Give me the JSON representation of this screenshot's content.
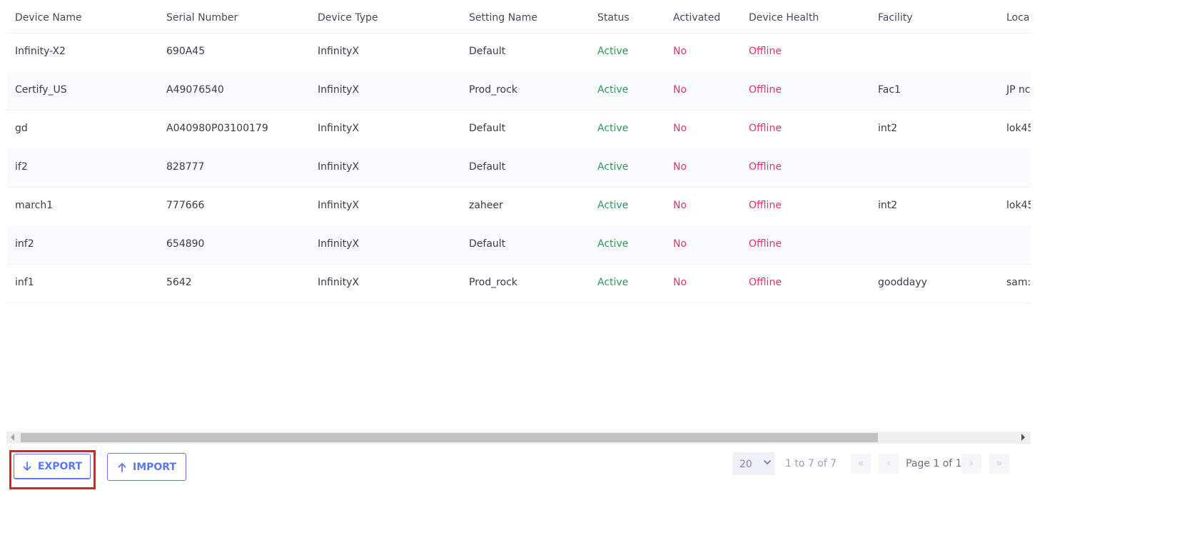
{
  "columns": [
    "Device Name",
    "Serial Number",
    "Device Type",
    "Setting Name",
    "Status",
    "Activated",
    "Device Health",
    "Facility",
    "Loca"
  ],
  "rows": [
    {
      "device_name": "Infinity-X2",
      "serial": "690A45",
      "type": "InfinityX",
      "setting": "Default",
      "status": "Active",
      "activated": "No",
      "health": "Offline",
      "facility": "",
      "location": ""
    },
    {
      "device_name": "Certify_US",
      "serial": "A49076540",
      "type": "InfinityX",
      "setting": "Prod_rock",
      "status": "Active",
      "activated": "No",
      "health": "Offline",
      "facility": "Fac1",
      "location": "JP nc"
    },
    {
      "device_name": "gd",
      "serial": "A040980P03100179",
      "type": "InfinityX",
      "setting": "Default",
      "status": "Active",
      "activated": "No",
      "health": "Offline",
      "facility": "int2",
      "location": "lok45"
    },
    {
      "device_name": "if2",
      "serial": "828777",
      "type": "InfinityX",
      "setting": "Default",
      "status": "Active",
      "activated": "No",
      "health": "Offline",
      "facility": "",
      "location": ""
    },
    {
      "device_name": "march1",
      "serial": "777666",
      "type": "InfinityX",
      "setting": "zaheer",
      "status": "Active",
      "activated": "No",
      "health": "Offline",
      "facility": "int2",
      "location": "lok45"
    },
    {
      "device_name": "inf2",
      "serial": "654890",
      "type": "InfinityX",
      "setting": "Default",
      "status": "Active",
      "activated": "No",
      "health": "Offline",
      "facility": "",
      "location": ""
    },
    {
      "device_name": "inf1",
      "serial": "5642",
      "type": "InfinityX",
      "setting": "Prod_rock",
      "status": "Active",
      "activated": "No",
      "health": "Offline",
      "facility": "gooddayy",
      "location": "sam:"
    }
  ],
  "actions": {
    "export_label": "EXPORT",
    "import_label": "IMPORT",
    "export_icon": "arrow-down-icon",
    "import_icon": "arrow-up-icon"
  },
  "pagination": {
    "page_size": "20",
    "range": "1 to 7 of 7",
    "page_label": "Page 1 of 1"
  },
  "colors": {
    "accent": "#5c77f6",
    "active": "#2e9b5a",
    "negative": "#e8336a",
    "highlight": "#e01f2a"
  }
}
